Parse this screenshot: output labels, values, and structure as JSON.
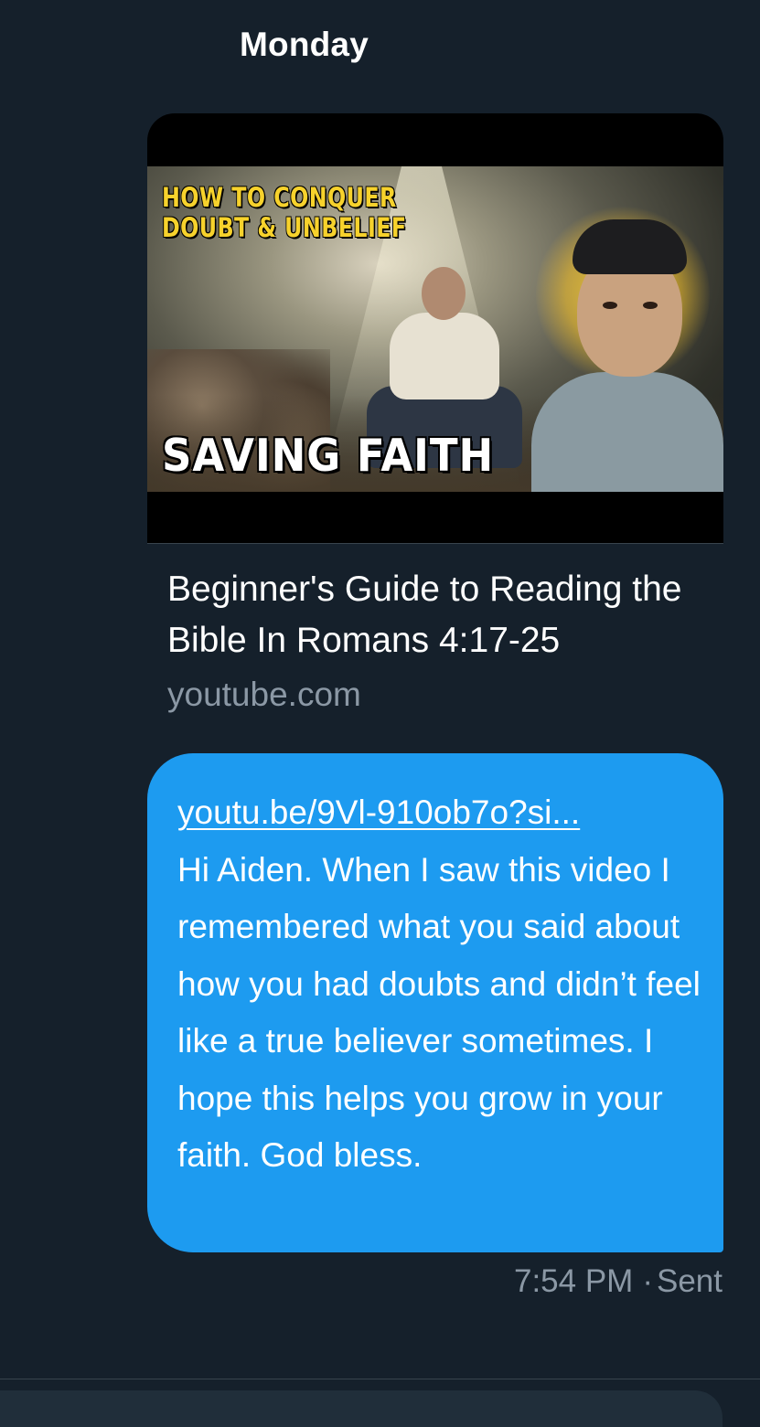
{
  "day_header": "Monday",
  "link_card": {
    "thumbnail": {
      "headline_top": "HOW TO CONQUER\nDOUBT & UNBELIEF",
      "headline_bottom": "SAVING FAITH"
    },
    "title": "Beginner's Guide to Reading the Bible In Romans 4:17-25",
    "domain": "youtube.com"
  },
  "message": {
    "link_text": "youtu.be/9Vl-910ob7o?si...",
    "body": "Hi Aiden. When I saw this video I remembered what you said about how you had doubts and didn’t feel like a true believer sometimes. I hope this helps you grow in your faith. God bless.",
    "time": "7:54 PM",
    "separator": "·",
    "status": "Sent"
  },
  "colors": {
    "background": "#15202b",
    "bubble": "#1d9bf0",
    "muted_text": "#8b98a5",
    "thumbnail_headline": "#f7d22c"
  }
}
